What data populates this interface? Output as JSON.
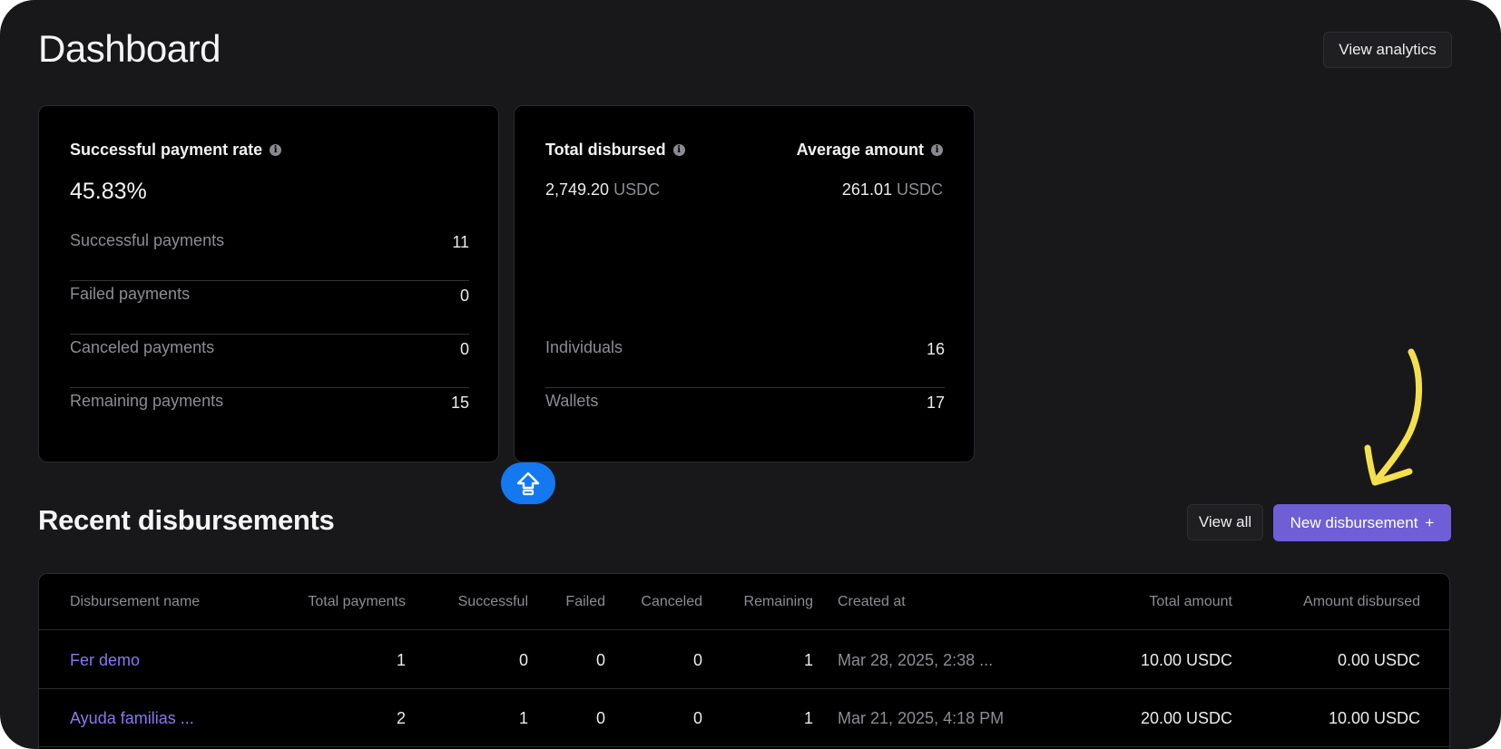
{
  "header": {
    "title": "Dashboard",
    "analytics_button": "View analytics"
  },
  "payment_card": {
    "rate_label": "Successful payment rate",
    "rate_value": "45.83%",
    "rows": [
      {
        "label": "Successful payments",
        "value": "11"
      },
      {
        "label": "Failed payments",
        "value": "0"
      },
      {
        "label": "Canceled payments",
        "value": "0"
      },
      {
        "label": "Remaining payments",
        "value": "15"
      }
    ]
  },
  "disbursed_card": {
    "total_label": "Total disbursed",
    "total_value": "2,749.20",
    "total_unit": "USDC",
    "average_label": "Average amount",
    "average_value": "261.01",
    "average_unit": "USDC",
    "rows": [
      {
        "label": "Individuals",
        "value": "16"
      },
      {
        "label": "Wallets",
        "value": "17"
      }
    ]
  },
  "recent": {
    "title": "Recent disbursements",
    "view_all_button": "View all",
    "new_button": "New disbursement",
    "new_button_icon": "+",
    "columns": [
      "Disbursement name",
      "Total payments",
      "Successful",
      "Failed",
      "Canceled",
      "Remaining",
      "Created at",
      "Total amount",
      "Amount disbursed"
    ],
    "rows": [
      {
        "name": "Fer demo",
        "total": "1",
        "successful": "0",
        "failed": "0",
        "canceled": "0",
        "remaining": "1",
        "created": "Mar 28, 2025, 2:38 ...",
        "total_amount": "10.00 USDC",
        "amount_disbursed": "0.00 USDC"
      },
      {
        "name": "Ayuda familias ...",
        "total": "2",
        "successful": "1",
        "failed": "0",
        "canceled": "0",
        "remaining": "1",
        "created": "Mar 21, 2025, 4:18 PM",
        "total_amount": "20.00 USDC",
        "amount_disbursed": "10.00 USDC"
      }
    ]
  },
  "icons": {
    "info": "info-icon",
    "fab": "upload-arrow-icon",
    "annotation": "hand-drawn-arrow"
  },
  "colors": {
    "background": "#18181a",
    "card": "#000000",
    "accent": "#6f5fd6",
    "link": "#8878f0",
    "fab": "#1478f0",
    "annotation": "#f4e04d"
  }
}
